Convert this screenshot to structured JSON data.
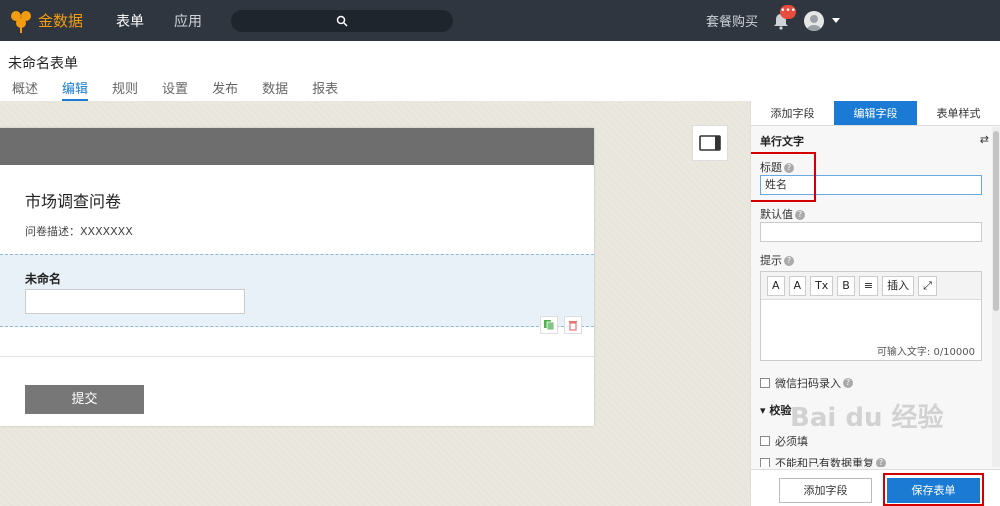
{
  "topbar": {
    "logo_text": "金数据",
    "nav": [
      "表单",
      "应用"
    ],
    "plan_link": "套餐购买",
    "notification_badge": "•••"
  },
  "header": {
    "form_title": "未命名表单",
    "tabs": [
      {
        "label": "概述",
        "active": false
      },
      {
        "label": "编辑",
        "active": true
      },
      {
        "label": "规则",
        "active": false
      },
      {
        "label": "设置",
        "active": false
      },
      {
        "label": "发布",
        "active": false
      },
      {
        "label": "数据",
        "active": false
      },
      {
        "label": "报表",
        "active": false
      }
    ]
  },
  "form": {
    "title": "市场调查问卷",
    "description": "问卷描述：XXXXXXX",
    "field_label": "未命名",
    "submit_label": "提交"
  },
  "panel": {
    "tabs": [
      {
        "label": "添加字段",
        "active": false
      },
      {
        "label": "编辑字段",
        "active": true
      },
      {
        "label": "表单样式",
        "active": false
      }
    ],
    "section_title": "单行文字",
    "title_label": "标题",
    "title_value": "姓名",
    "default_label": "默认值",
    "default_value": "",
    "hint_label": "提示",
    "editor_buttons": [
      "A",
      "A",
      "Tx",
      "B",
      "≡",
      "插入",
      "⤢"
    ],
    "char_count": "可输入文字: 0/10000",
    "wechat_scan": "微信扫码录入",
    "validation_title": "校验",
    "validation_required": "必须填",
    "validation_unique": "不能和已有数据重复",
    "add_field_button": "添加字段",
    "save_button": "保存表单"
  },
  "colors": {
    "topbar": "#2f3640",
    "accent": "#1a7ad4",
    "logo": "#f39c12",
    "highlight_box": "#d40000"
  }
}
